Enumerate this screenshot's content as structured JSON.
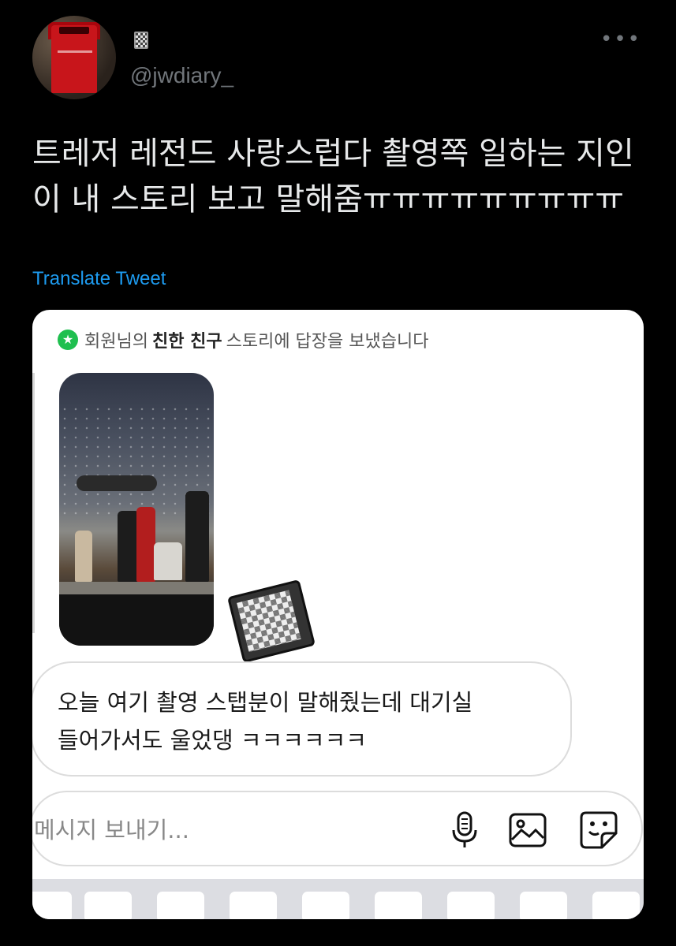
{
  "author": {
    "handle": "@jwdiary_",
    "avatar_icon": "red-trash-bin-avatar",
    "name_icon": "notebook-icon"
  },
  "more_icon": "more-dots-icon",
  "tweet": {
    "line1": "트레저 레전드 사랑스럽다 촬영쪽 일하는 지인",
    "line2": "이 내 스토리 보고 말해줌ㅠㅠㅠㅠㅠㅠㅠㅠㅠ",
    "translate_label": "Translate Tweet"
  },
  "screenshot": {
    "header_prefix": "회원님의",
    "header_bold": "친한 친구",
    "header_suffix": "스토리에 답장을 보냈습니다",
    "header_icon": "star-icon",
    "message_line1": "오늘 여기 촬영 스탭분이 말해줬는데 대기실",
    "message_line2": "들어가서도 울었댕 ㅋㅋㅋㅋㅋㅋ",
    "composer_placeholder": "메시지 보내기...",
    "icons": [
      "mic-icon",
      "image-icon",
      "sticker-icon"
    ],
    "accent_green": "#1fbf4f",
    "link_blue": "#1d9bf0"
  }
}
